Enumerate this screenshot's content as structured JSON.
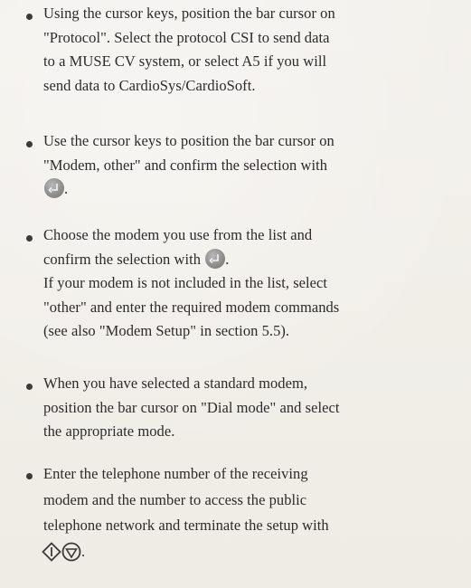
{
  "steps": [
    {
      "lines": [
        "Using the cursor keys, position the bar cursor on",
        "\"Protocol\". Select the protocol CSI to send data",
        "to a MUSE CV system, or select A5 if you will",
        "send data to CardioSys/CardioSoft."
      ]
    },
    {
      "lines": [
        "Use the cursor keys to position the bar cursor on",
        "\"Modem, other\" and confirm the selection with",
        "."
      ],
      "icon": "enter-key-icon"
    },
    {
      "lines": [
        "Choose the modem you use from the list and",
        "confirm the selection with",
        ".",
        "If your modem is not included in the list, select",
        "\"other\" and enter the required modem commands",
        "(see also \"Modem Setup\" in section 5.5)."
      ],
      "icon": "enter-key-icon"
    },
    {
      "lines": [
        "When you have selected a standard modem,",
        "position the bar cursor on \"Dial mode\" and select",
        "the appropriate mode."
      ]
    },
    {
      "lines": [
        "Enter the telephone number of the receiving",
        "modem and the number to access the public",
        "telephone network and terminate the setup with",
        "."
      ],
      "icons": [
        "start-key-icon",
        "stop-key-icon"
      ]
    }
  ]
}
